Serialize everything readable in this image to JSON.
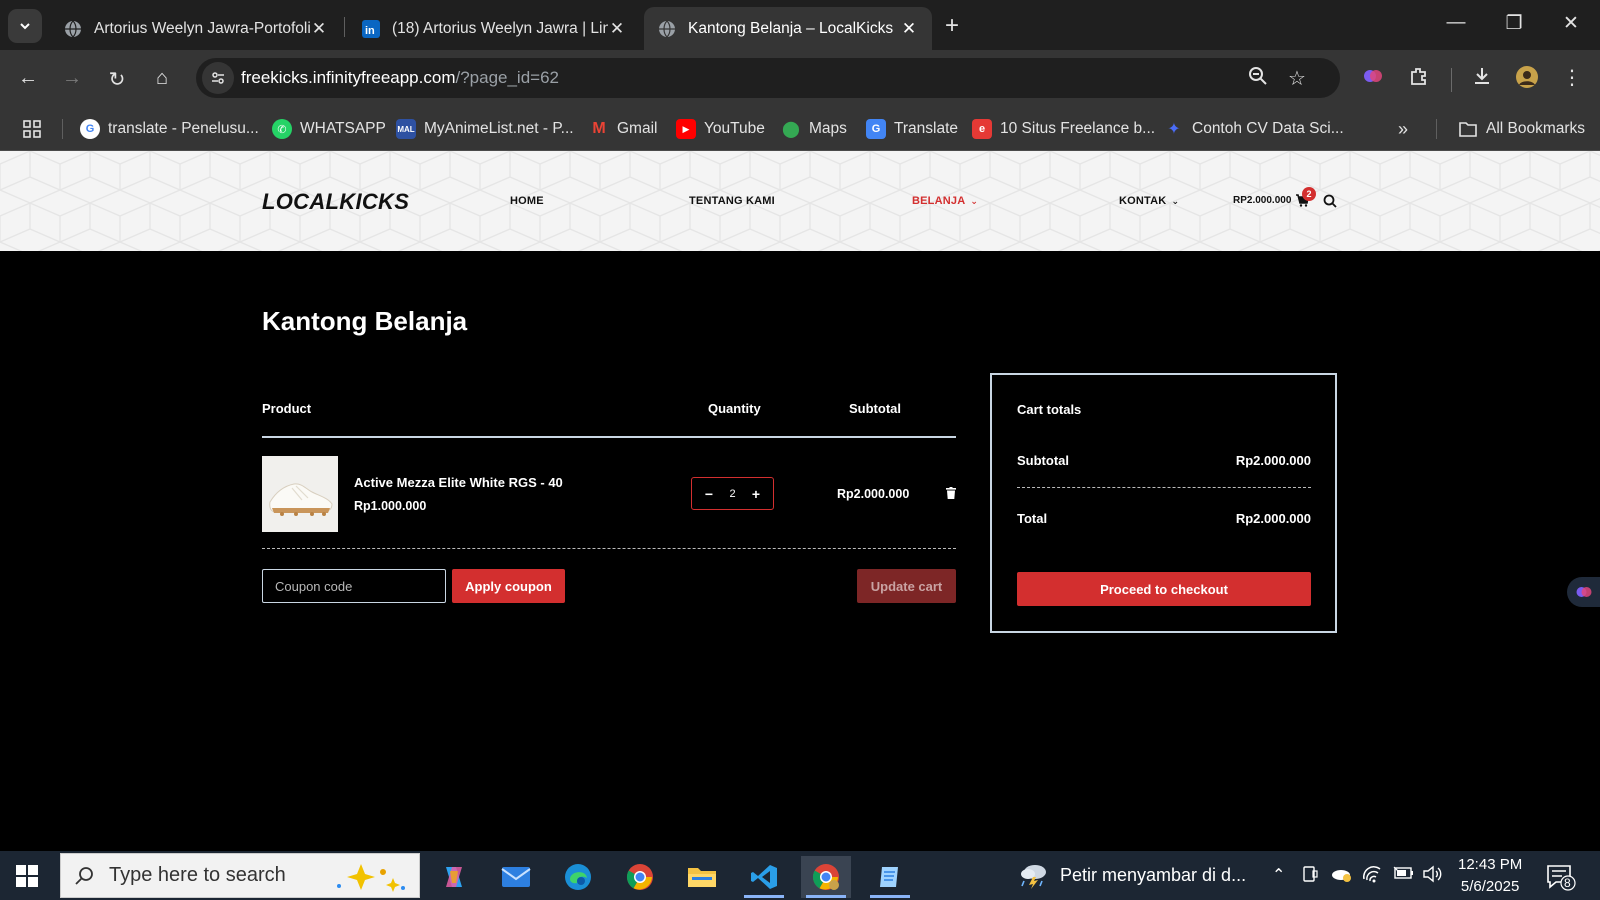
{
  "browser": {
    "tabs": [
      {
        "title": "Artorius Weelyn Jawra-Portofoli",
        "icon": "globe-icon"
      },
      {
        "title": "(18) Artorius Weelyn Jawra | Lin",
        "icon": "linkedin-icon"
      },
      {
        "title": "Kantong Belanja – LocalKicks",
        "icon": "globe-icon"
      }
    ],
    "url_host": "freekicks.infinityfreeapp.com",
    "url_path": "/?page_id=62",
    "bookmarks": [
      {
        "label": "translate - Penelusu...",
        "icon": "google-icon",
        "color": "#ffffff"
      },
      {
        "label": "WHATSAPP",
        "icon": "whatsapp-icon",
        "color": "#25d366"
      },
      {
        "label": "MyAnimeList.net - P...",
        "icon": "mal-icon",
        "color": "#2e51a2"
      },
      {
        "label": "Gmail",
        "icon": "gmail-icon",
        "color": "#ea4335"
      },
      {
        "label": "YouTube",
        "icon": "youtube-icon",
        "color": "#ff0000"
      },
      {
        "label": "Maps",
        "icon": "maps-icon",
        "color": "#34a853"
      },
      {
        "label": "Translate",
        "icon": "translate-icon",
        "color": "#4285f4"
      },
      {
        "label": "10 Situs Freelance b...",
        "icon": "site-icon",
        "color": "#e53935"
      },
      {
        "label": "Contoh CV Data Sci...",
        "icon": "gemini-icon",
        "color": "#4a6cf7"
      }
    ],
    "all_bookmarks": "All Bookmarks"
  },
  "site": {
    "logo": "LOCALKICKS",
    "nav": {
      "home": "HOME",
      "about": "TENTANG KAMI",
      "shop": "BELANJA",
      "contact": "KONTAK"
    },
    "cart_amount": "RP2.000.000",
    "cart_count": "2",
    "accent": "#d32f2f"
  },
  "cart": {
    "title": "Kantong Belanja",
    "headers": {
      "product": "Product",
      "quantity": "Quantity",
      "subtotal": "Subtotal"
    },
    "items": [
      {
        "name": "Active Mezza Elite White RGS - 40",
        "price": "Rp1.000.000",
        "quantity": "2",
        "subtotal": "Rp2.000.000"
      }
    ],
    "coupon_placeholder": "Coupon code",
    "apply_coupon": "Apply coupon",
    "update_cart": "Update cart"
  },
  "totals": {
    "title": "Cart totals",
    "subtotal_label": "Subtotal",
    "subtotal_value": "Rp2.000.000",
    "total_label": "Total",
    "total_value": "Rp2.000.000",
    "checkout": "Proceed to checkout"
  },
  "taskbar": {
    "search_placeholder": "Type here to search",
    "weather_text": "Petir menyambar di d...",
    "time": "12:43 PM",
    "date": "5/6/2025",
    "notification_count": "8"
  }
}
